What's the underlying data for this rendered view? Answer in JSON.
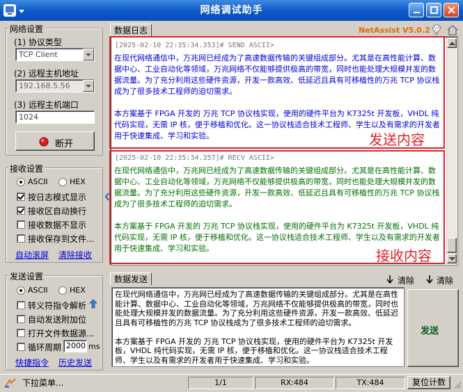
{
  "window": {
    "title": "网络调试助手",
    "brand": "NetAssist V5.0.2"
  },
  "network": {
    "group_title": "网络设置",
    "protocol_label": "(1) 协议类型",
    "protocol_value": "TCP Client",
    "host_label": "(2) 远程主机地址",
    "host_value": "192.168.5.56",
    "port_label": "(3) 远程主机端口",
    "port_value": "1024",
    "disconnect_label": "断开"
  },
  "receive": {
    "group_title": "接收设置",
    "ascii_label": "ASCII",
    "hex_label": "HEX",
    "encoding_selected": "ASCII",
    "options": [
      {
        "label": "按日志模式显示",
        "checked": true
      },
      {
        "label": "接收区自动换行",
        "checked": true
      },
      {
        "label": "接收数据不显示",
        "checked": false
      },
      {
        "label": "接收保存到文件...",
        "checked": false
      }
    ],
    "auto_scroll_link": "自动滚屏",
    "clear_link": "清除接收"
  },
  "send_settings": {
    "group_title": "发送设置",
    "ascii_label": "ASCII",
    "hex_label": "HEX",
    "encoding_selected": "ASCII",
    "escape_label": "转义符指令解析",
    "append_label": "自动发送附加位",
    "file_label": "打开文件数据源...",
    "cycle_label": "循环周期",
    "cycle_value": "2000",
    "cycle_unit": "ms",
    "shortcut_link": "快捷指令",
    "history_link": "历史发送"
  },
  "log": {
    "tab_label": "数据日志",
    "send_header": "[2025-02-10 22:35:34.353]# SEND ASCII>",
    "send_para1": "在现代网络通信中，万兆网已经成为了高速数据传输的关键组成部分。尤其是在高性能计算、数据中心、工业自动化等领域，万兆网络不仅能够提供极高的带宽，同时也能处理大规模并发的数据流量。为了充分利用这些硬件资源，开发一款高效、低延迟且具有可移植性的万兆 TCP 协议栈成为了很多技术工程师的迫切需求。",
    "send_para2": "本方案基于 FPGA 开发的 万兆 TCP 协议栈实现，使用的硬件平台为 K7325t 开发板，VHDL 纯代码实现，无需 IP 核，便于移植和优化。这一协议栈适合技术工程师、学生以及有需求的开发者用于快速集成、学习和实验。",
    "send_annotation": "发送内容",
    "recv_header": "[2025-02-10 22:35:34.357]# RECV ASCII>",
    "recv_para1": "在现代网络通信中，万兆网已经成为了高速数据传输的关键组成部分。尤其是在高性能计算、数据中心、工业自动化等领域，万兆网络不仅能够提供极高的带宽，同时也能处理大规模并发的数据流量。为了充分利用这些硬件资源，开发一款高效、低延迟且具有可移植性的万兆 TCP 协议栈成为了很多技术工程师的迫切需求。",
    "recv_para2": "本方案基于 FPGA 开发的 万兆 TCP 协议栈实现，使用的硬件平台为 K7325t 开发板，VHDL 纯代码实现，无需 IP 核，便于移植和优化。这一协议栈适合技术工程师、学生以及有需求的开发者用于快速集成、学习和实验。",
    "recv_annotation": "接收内容"
  },
  "send_panel": {
    "tab_label": "数据发送",
    "clear1_label": "清除",
    "clear2_label": "清除",
    "text": "在现代网络通信中，万兆网已经成为了高速数据传输的关键组成部分。尤其是在高性能计算、数据中心、工业自动化等领域，万兆网络不仅能够提供极高的带宽，同时也能处理大规模并发的数据流量。为了充分利用这些硬件资源，开发一款高效、低延迟且具有可移植性的万兆 TCP 协议栈成为了很多技术工程师的迫切需求。\n\n本方案基于 FPGA 开发的 万兆 TCP 协议栈实现，使用的硬件平台为 K7325t 开发板，VHDL 纯代码实现，无需 IP 核，便于移植和优化。这一协议栈适合技术工程师、学生以及有需求的开发者用于快速集成、学习和实验。",
    "send_button": "发送"
  },
  "status": {
    "menu_label": "下拉菜单...",
    "page": "1/1",
    "rx": "RX:484",
    "tx": "TX:484",
    "reset_label": "复位计数"
  },
  "colors": {
    "accent_red": "#e0202a",
    "send_text": "#0000d8",
    "recv_text": "#007000",
    "title_blue": "#0b56c8"
  }
}
